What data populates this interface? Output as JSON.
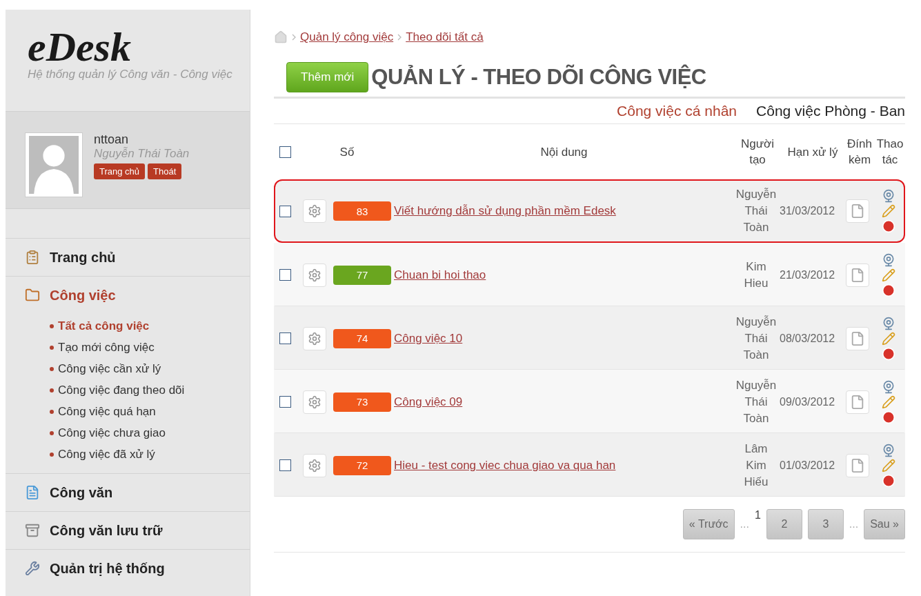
{
  "logo": {
    "title": "eDesk",
    "subtitle": "Hệ thống quản lý Công văn - Công việc"
  },
  "user": {
    "username": "nttoan",
    "full_name": "Nguyễn Thái Toàn",
    "buttons": [
      "Trang chủ",
      "Thoát"
    ]
  },
  "nav": [
    {
      "label": "Trang chủ",
      "selected": false
    },
    {
      "label": "Công việc",
      "selected": true,
      "children": [
        {
          "label": "Tất cả công việc",
          "selected": true
        },
        {
          "label": "Tạo mới công việc",
          "selected": false
        },
        {
          "label": "Công việc cần xử lý",
          "selected": false
        },
        {
          "label": "Công việc đang theo dõi",
          "selected": false
        },
        {
          "label": "Công việc quá hạn",
          "selected": false
        },
        {
          "label": "Công việc chưa giao",
          "selected": false
        },
        {
          "label": "Công việc đã xử lý",
          "selected": false
        }
      ]
    },
    {
      "label": "Công văn",
      "selected": false
    },
    {
      "label": "Công văn lưu trữ",
      "selected": false
    },
    {
      "label": "Quản trị hệ thống",
      "selected": false
    }
  ],
  "breadcrumb": [
    "Quản lý công việc",
    "Theo dõi tất cả"
  ],
  "add_button": "Thêm mới",
  "title": "QUẢN LÝ - THEO DÕI CÔNG VIỆC",
  "tabs": [
    {
      "label": "Công việc cá nhân",
      "selected": true
    },
    {
      "label": "Công việc Phòng - Ban",
      "selected": false
    }
  ],
  "table": {
    "select_all_checked": false,
    "columns": [
      "Số",
      "Nội dung",
      "Người tạo",
      "Hạn xử lý",
      "Đính kèm",
      "Thao tác"
    ],
    "rows": [
      {
        "number": "83",
        "color": "#f0581c",
        "content": "Viết hướng dẫn sử dụng phần mềm Edesk",
        "creator": "Nguyễn Thái Toàn",
        "deadline": "31/03/2012",
        "checked": false,
        "highlighted": true
      },
      {
        "number": "77",
        "color": "#6aa61f",
        "content": "Chuan bi hoi thao",
        "creator": "Kim Hieu",
        "deadline": "21/03/2012",
        "checked": false,
        "highlighted": false
      },
      {
        "number": "74",
        "color": "#f0581c",
        "content": "Công việc 10",
        "creator": "Nguyễn Thái Toàn",
        "deadline": "08/03/2012",
        "checked": false,
        "highlighted": false
      },
      {
        "number": "73",
        "color": "#f0581c",
        "content": "Công việc 09",
        "creator": "Nguyễn Thái Toàn",
        "deadline": "09/03/2012",
        "checked": false,
        "highlighted": false
      },
      {
        "number": "72",
        "color": "#f0581c",
        "content": "Hieu - test cong viec chua giao va qua han",
        "creator": "Lâm Kim Hiếu",
        "deadline": "01/03/2012",
        "checked": false,
        "highlighted": false
      }
    ]
  },
  "pagination": [
    {
      "kind": "button",
      "label": "« Trước"
    },
    {
      "kind": "ellipsis",
      "label": "..."
    },
    {
      "kind": "current",
      "label": "1"
    },
    {
      "kind": "button",
      "label": "2"
    },
    {
      "kind": "button",
      "label": "3"
    },
    {
      "kind": "ellipsis",
      "label": "..."
    },
    {
      "kind": "button",
      "label": "Sau »"
    }
  ]
}
